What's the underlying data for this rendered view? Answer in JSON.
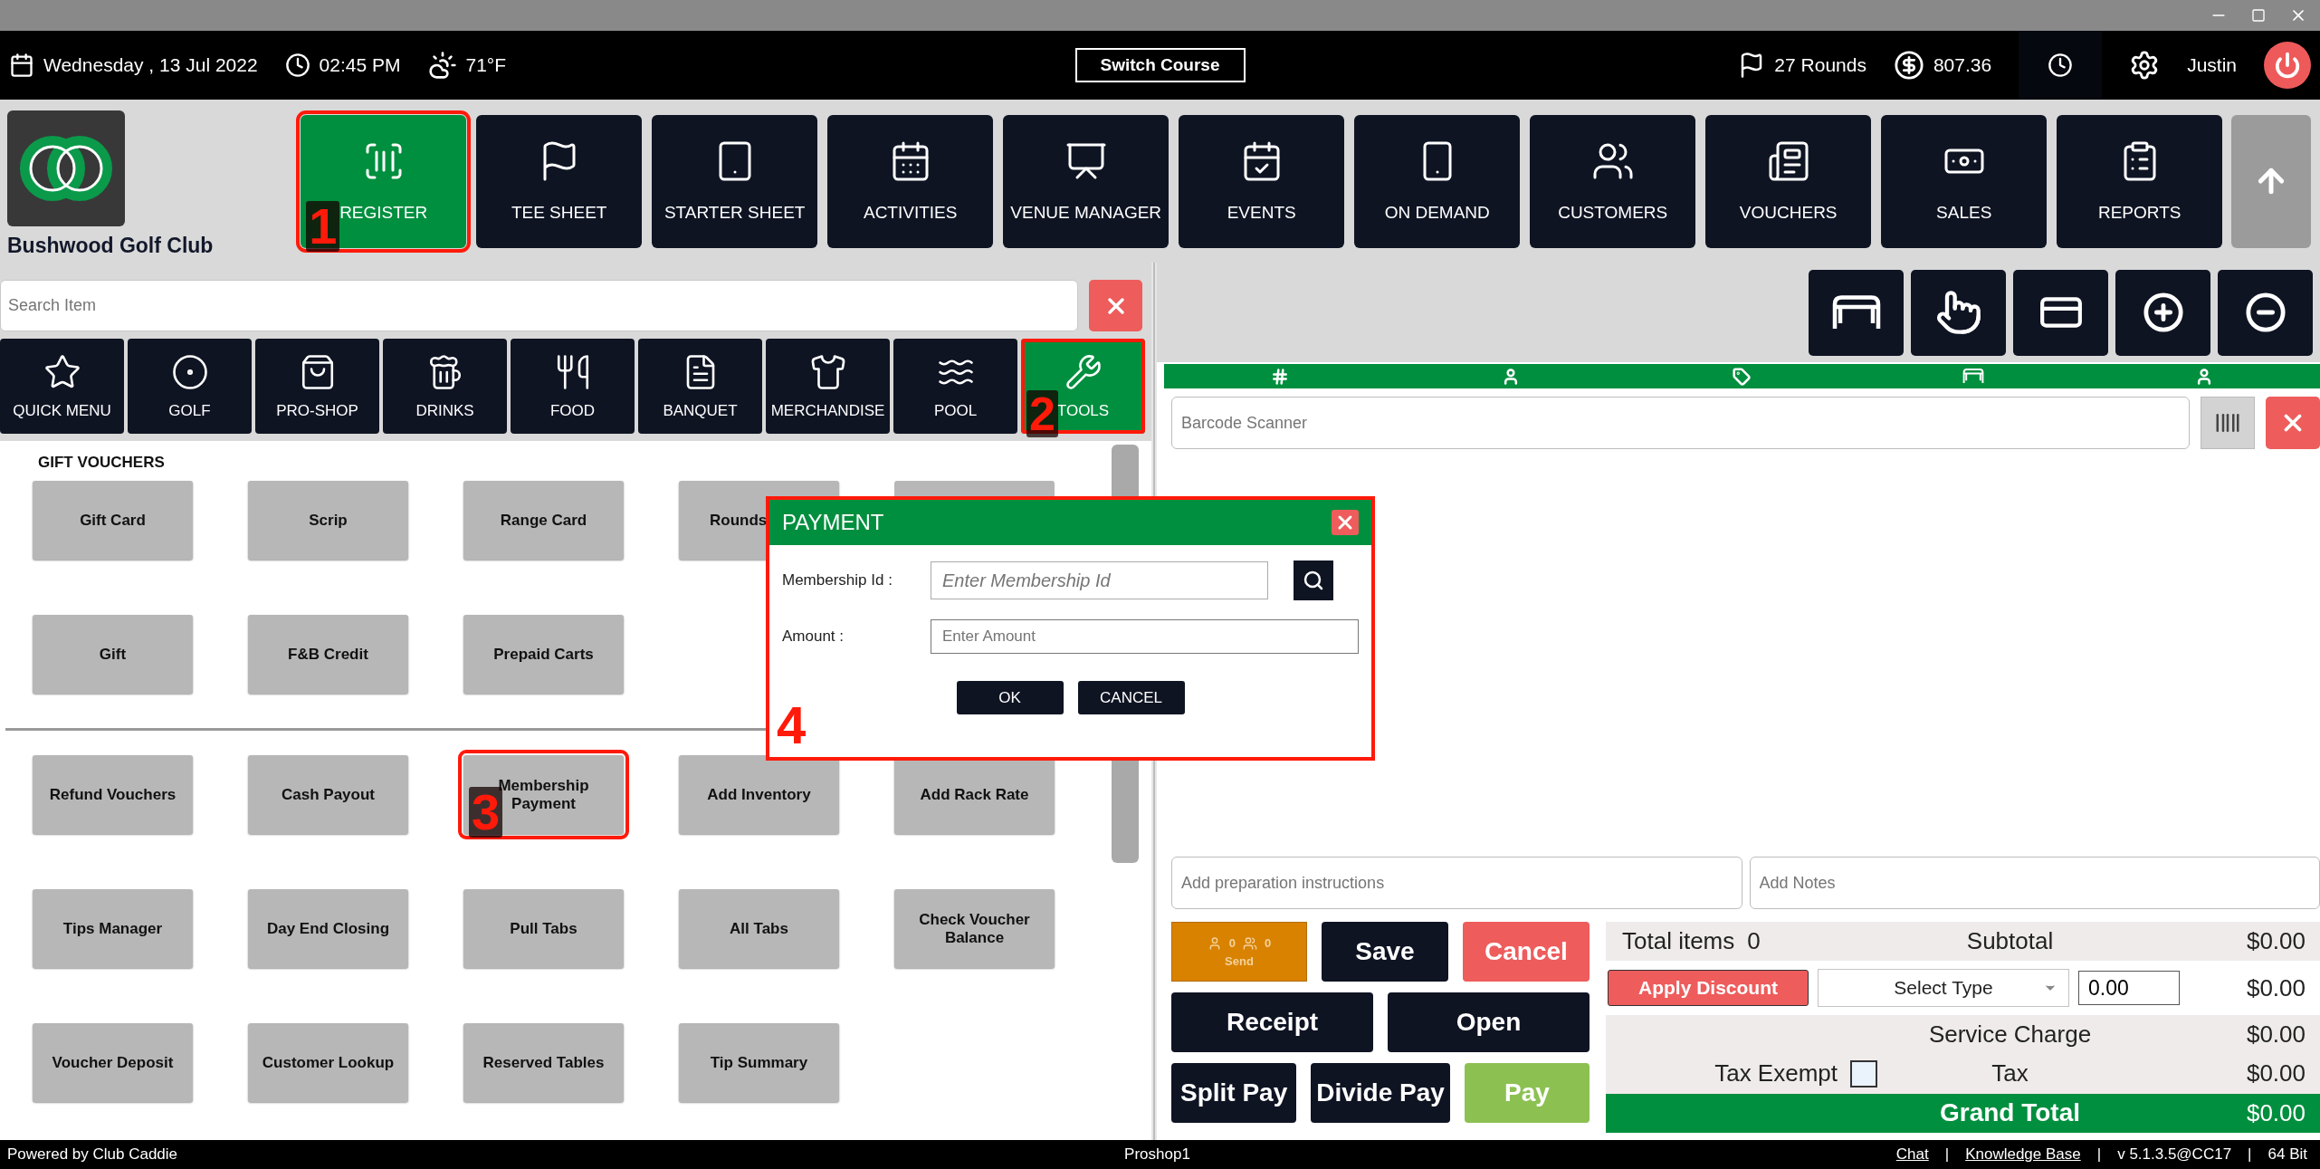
{
  "top_bar": {
    "date": "Wednesday ,  13 Jul 2022",
    "time": "02:45 PM",
    "weather": "71°F",
    "switch_button": "Switch Course",
    "rounds": "27 Rounds",
    "balance": "807.36",
    "user": "Justin"
  },
  "club": {
    "name": "Bushwood Golf Club"
  },
  "nav": [
    {
      "label": "REGISTER",
      "selected": true,
      "highlighted": true,
      "annotation": "1"
    },
    {
      "label": "TEE SHEET",
      "selected": false
    },
    {
      "label": "STARTER SHEET",
      "selected": false
    },
    {
      "label": "ACTIVITIES",
      "selected": false
    },
    {
      "label": "VENUE MANAGER",
      "selected": false
    },
    {
      "label": "EVENTS",
      "selected": false
    },
    {
      "label": "ON DEMAND",
      "selected": false
    },
    {
      "label": "CUSTOMERS",
      "selected": false
    },
    {
      "label": "VOUCHERS",
      "selected": false
    },
    {
      "label": "SALES",
      "selected": false
    },
    {
      "label": "REPORTS",
      "selected": false
    }
  ],
  "search": {
    "placeholder": "Search Item"
  },
  "categories": [
    {
      "label": "QUICK MENU",
      "selected": false
    },
    {
      "label": "GOLF",
      "selected": false
    },
    {
      "label": "PRO-SHOP",
      "selected": false
    },
    {
      "label": "DRINKS",
      "selected": false
    },
    {
      "label": "FOOD",
      "selected": false
    },
    {
      "label": "BANQUET",
      "selected": false
    },
    {
      "label": "MERCHANDISE",
      "selected": false
    },
    {
      "label": "POOL",
      "selected": false
    },
    {
      "label": "TOOLS",
      "selected": true,
      "highlighted": true,
      "annotation": "2"
    }
  ],
  "sections": [
    {
      "title": "GIFT VOUCHERS",
      "items": [
        {
          "label": "Gift Card",
          "kind": "button"
        },
        {
          "label": "Scrip",
          "kind": "button"
        },
        {
          "label": "Range Card",
          "kind": "button"
        },
        {
          "label": "Rounds",
          "kind": "cut"
        },
        {
          "kind": "hidden"
        },
        {
          "label": "Gift",
          "kind": "button"
        },
        {
          "label": "F&B Credit",
          "kind": "button"
        },
        {
          "label": "Prepaid Carts",
          "kind": "button"
        }
      ]
    },
    {
      "items": [
        {
          "label": "Refund Vouchers",
          "kind": "button"
        },
        {
          "label": "Cash Payout",
          "kind": "button"
        },
        {
          "label": "Membership Payment",
          "kind": "button",
          "highlighted": true,
          "annotation": "3"
        },
        {
          "label": "Add Inventory",
          "kind": "button"
        },
        {
          "label": "Add Rack Rate",
          "kind": "button"
        },
        {
          "label": "Tips Manager",
          "kind": "button"
        },
        {
          "label": "Day End Closing",
          "kind": "button"
        },
        {
          "label": "Pull Tabs",
          "kind": "button"
        },
        {
          "label": "All Tabs",
          "kind": "button"
        },
        {
          "label": "Check Voucher Balance",
          "kind": "button"
        },
        {
          "label": "Voucher Deposit",
          "kind": "button"
        },
        {
          "label": "Customer Lookup",
          "kind": "button"
        },
        {
          "label": "Reserved Tables",
          "kind": "button"
        },
        {
          "label": "Tip Summary",
          "kind": "button"
        }
      ]
    }
  ],
  "dialog": {
    "title": "PAYMENT",
    "annotation": "4",
    "highlighted": true,
    "fields": [
      {
        "label": "Membership Id :",
        "placeholder": "Enter Membership Id",
        "kind": "search"
      },
      {
        "label": "Amount :",
        "placeholder": "Enter Amount",
        "kind": "plain"
      }
    ],
    "buttons": [
      "OK",
      "CANCEL"
    ]
  },
  "order": {
    "barcode_placeholder": "Barcode Scanner",
    "prep_placeholder": "Add preparation instructions",
    "notes_placeholder": "Add Notes",
    "send": {
      "label": "Send",
      "count_1": "0",
      "count_2": "0"
    },
    "action_rows": [
      [
        {
          "label": "Save",
          "kind": "dark"
        },
        {
          "label": "Cancel",
          "kind": "danger"
        }
      ],
      [
        {
          "label": "Receipt",
          "kind": "dark"
        },
        {
          "label": "Open",
          "kind": "dark"
        }
      ],
      [
        {
          "label": "Split Pay",
          "kind": "dark"
        },
        {
          "label": "Divide Pay",
          "kind": "dark"
        },
        {
          "label": "Pay",
          "kind": "success"
        }
      ]
    ]
  },
  "summary": {
    "total_items_label": "Total items",
    "total_items": "0",
    "subtotal_label": "Subtotal",
    "subtotal": "$0.00",
    "discount_button": "Apply Discount",
    "discount_type": "Select Type",
    "discount_value": "0.00",
    "discount": "$0.00",
    "service_charge_label": "Service Charge",
    "service_charge": "$0.00",
    "tax_exempt_label": "Tax Exempt",
    "tax_exempt": false,
    "tax_label": "Tax",
    "tax": "$0.00",
    "grand_total_label": "Grand Total",
    "grand_total": "$0.00"
  },
  "status_bar": {
    "left": "Powered by Club Caddie",
    "center": "Proshop1",
    "right": [
      {
        "text": "Chat",
        "kind": "link"
      },
      {
        "text": "|",
        "kind": "separator"
      },
      {
        "text": "Knowledge Base",
        "kind": "link"
      },
      {
        "text": "|",
        "kind": "separator"
      },
      {
        "text": "v 5.1.3.5@CC17",
        "kind": "text"
      },
      {
        "text": "|",
        "kind": "separator"
      },
      {
        "text": "64 Bit",
        "kind": "text"
      }
    ]
  }
}
